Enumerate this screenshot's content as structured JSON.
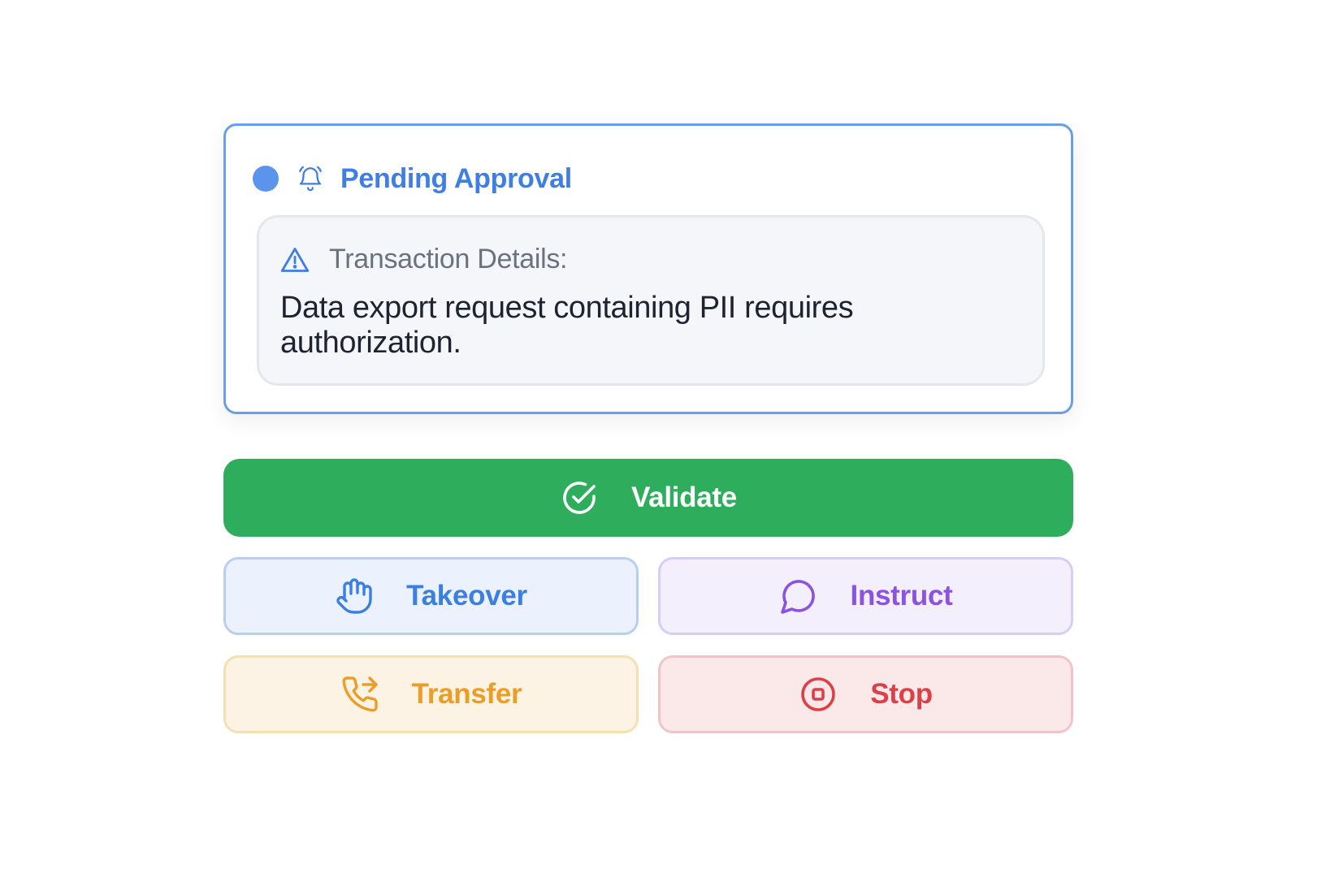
{
  "approval": {
    "status": "Pending Approval",
    "status_color": "#3f7ee3",
    "dot_color": "#5b94ec",
    "icon": "bell-icon",
    "details": {
      "icon": "warning-triangle-icon",
      "label": "Transaction Details:",
      "message": "Data export request containing PII requires authorization."
    }
  },
  "actions": {
    "validate": {
      "label": "Validate",
      "icon": "check-circle-icon",
      "color": "#2eae5c"
    },
    "takeover": {
      "label": "Takeover",
      "icon": "hand-icon",
      "color": "#3b7fe0"
    },
    "instruct": {
      "label": "Instruct",
      "icon": "chat-bubble-icon",
      "color": "#8c52e0"
    },
    "transfer": {
      "label": "Transfer",
      "icon": "phone-forward-icon",
      "color": "#eb9e27"
    },
    "stop": {
      "label": "Stop",
      "icon": "stop-circle-icon",
      "color": "#dd3f48"
    }
  }
}
